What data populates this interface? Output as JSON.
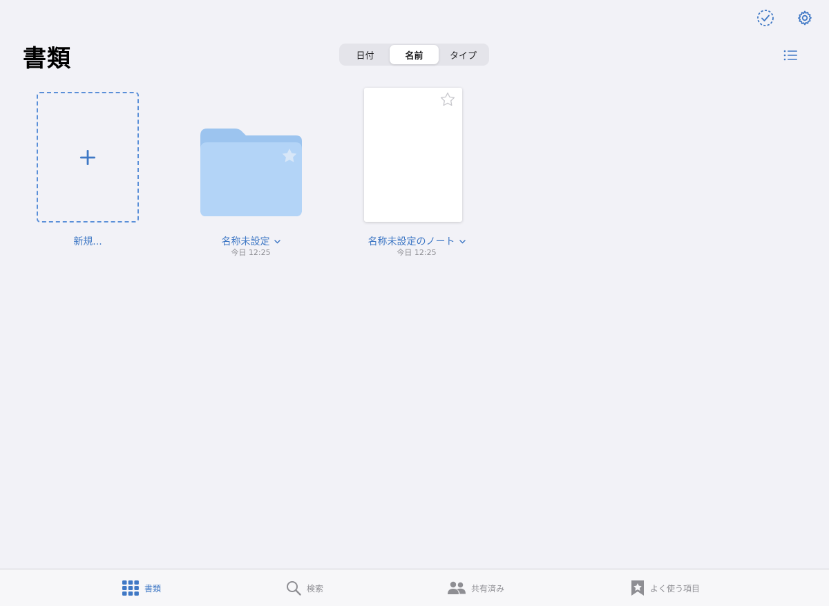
{
  "header": {
    "title": "書類",
    "sort_tabs": [
      {
        "label": "日付",
        "active": false
      },
      {
        "label": "名前",
        "active": true
      },
      {
        "label": "タイプ",
        "active": false
      }
    ]
  },
  "toolbar": {
    "select_icon": "checkmark-circle-icon",
    "settings_icon": "gear-icon",
    "list_view_icon": "list-icon"
  },
  "items": {
    "new_label": "新規...",
    "folder": {
      "name": "名称未設定",
      "date": "今日 12:25"
    },
    "document": {
      "name": "名称未設定のノート",
      "date": "今日 12:25"
    }
  },
  "tabbar": {
    "tabs": [
      {
        "label": "書類",
        "icon": "grid-icon",
        "active": true
      },
      {
        "label": "検索",
        "icon": "search-icon",
        "active": false
      },
      {
        "label": "共有済み",
        "icon": "people-icon",
        "active": false
      },
      {
        "label": "よく使う項目",
        "icon": "bookmark-star-icon",
        "active": false
      }
    ]
  },
  "colors": {
    "accent": "#3f78c5",
    "background": "#f2f2f7",
    "folder": "#b3d4f7"
  }
}
